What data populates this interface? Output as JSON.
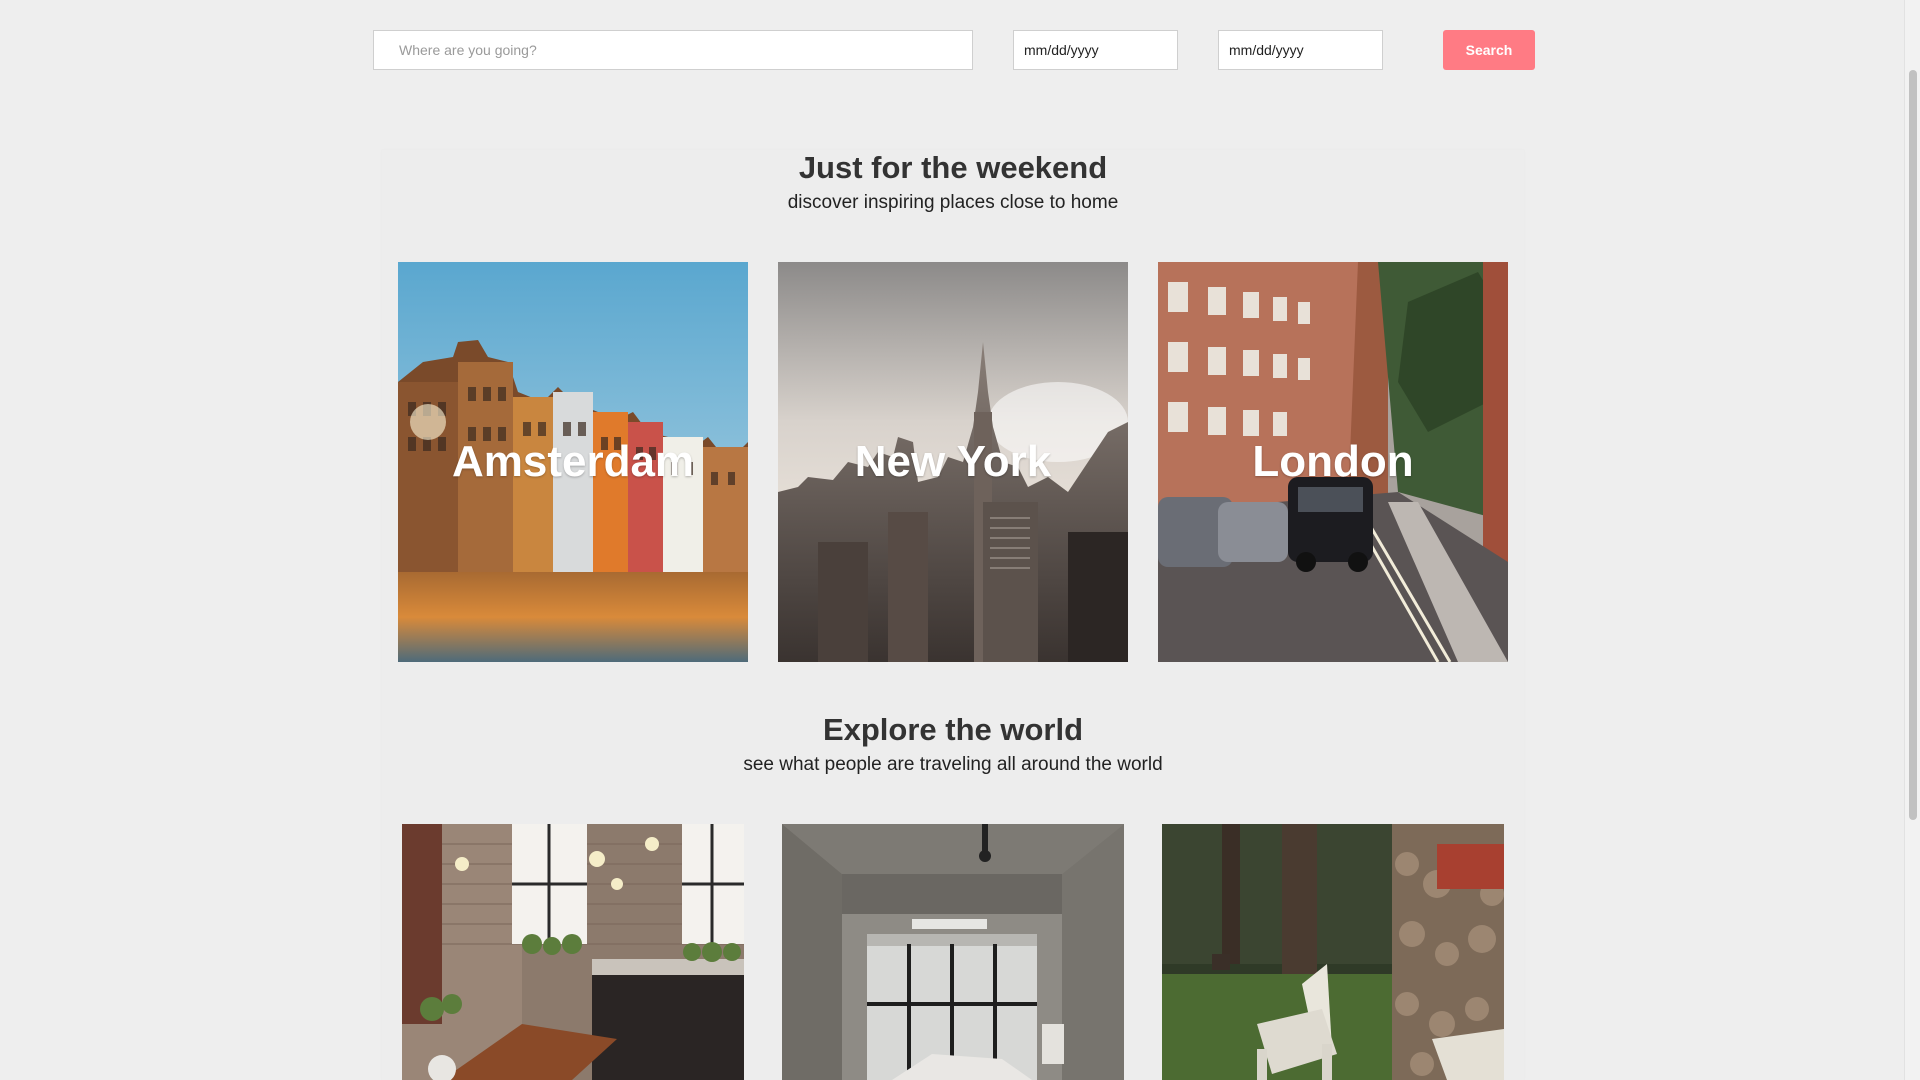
{
  "search": {
    "destination_placeholder": "Where are you going?",
    "checkin_placeholder": "mm/dd/yyyy",
    "checkout_placeholder": "mm/dd/yyyy",
    "button_label": "Search"
  },
  "weekend": {
    "title": "Just for the weekend",
    "subtitle": "discover inspiring places close to home",
    "cities": [
      {
        "name": "Amsterdam"
      },
      {
        "name": "New York"
      },
      {
        "name": "London"
      }
    ]
  },
  "explore": {
    "title": "Explore the world",
    "subtitle": "see what people are traveling all around the world"
  },
  "colors": {
    "accent": "#ff7b84",
    "background": "#eeeeee"
  }
}
